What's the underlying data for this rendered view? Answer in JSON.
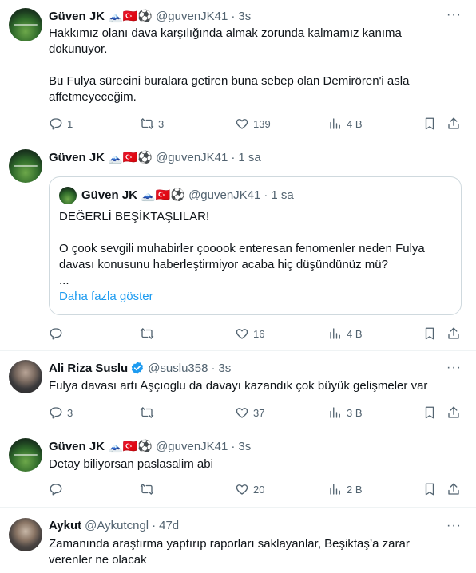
{
  "tweets": [
    {
      "name": "Güven JK",
      "badges": "🗻🇹🇷⚽",
      "handle": "@guvenJK41",
      "time": "3s",
      "text_lines": [
        "Hakkımız olanı dava karşılığında almak zorunda kalmamız kanıma",
        "dokunuyor.",
        "",
        "Bu Fulya sürecini buralara getiren buna sebep olan Demirören'i asla",
        "affetmeyeceğim."
      ],
      "replies": "1",
      "retweets": "3",
      "likes": "139",
      "views": "4 B"
    },
    {
      "name": "Güven JK",
      "badges": "🗻🇹🇷⚽",
      "handle": "@guvenJK41",
      "time": "1 sa",
      "quote": {
        "name": "Güven JK",
        "badges": "🗻🇹🇷⚽",
        "handle": "@guvenJK41",
        "time": "1 sa",
        "line1": "DEĞERLİ BEŞİKTAŞLILAR!",
        "line2": "O çook sevgili muhabirler çooook enteresan fenomenler neden Fulya",
        "line3": "davası konusunu haberleştirmiyor acaba hiç düşündünüz mü?",
        "line4": "...",
        "show_more": "Daha fazla göster"
      },
      "replies": "",
      "retweets": "",
      "likes": "16",
      "views": "4 B"
    },
    {
      "name": "Ali Riza Suslu",
      "verified": true,
      "handle": "@suslu358",
      "time": "3s",
      "text_lines": [
        "Fulya davası artı Aşçıoglu da davayı kazandık çok büyük gelişmeler var"
      ],
      "replies": "3",
      "retweets": "",
      "likes": "37",
      "views": "3 B"
    },
    {
      "name": "Güven JK",
      "badges": "🗻🇹🇷⚽",
      "handle": "@guvenJK41",
      "time": "3s",
      "text_lines": [
        "Detay biliyorsan paslasalim abi"
      ],
      "replies": "",
      "retweets": "",
      "likes": "20",
      "views": "2 B"
    },
    {
      "name": "Aykut",
      "handle": "@Aykutcngl",
      "time": "47d",
      "text_lines": [
        "Zamanında araştırma yaptırıp raporları saklayanlar, Beşiktaş’a zarar",
        "verenler ne olacak"
      ]
    }
  ],
  "separator": "·",
  "more_label": "···",
  "colors": {
    "text": "#0f1419",
    "muted": "#536471",
    "link": "#1d9bf0",
    "border": "#eff3f4",
    "verified": "#1d9bf0"
  },
  "icons": [
    "reply-icon",
    "retweet-icon",
    "like-icon",
    "views-icon",
    "bookmark-icon",
    "share-icon",
    "verified-icon",
    "more-icon"
  ]
}
